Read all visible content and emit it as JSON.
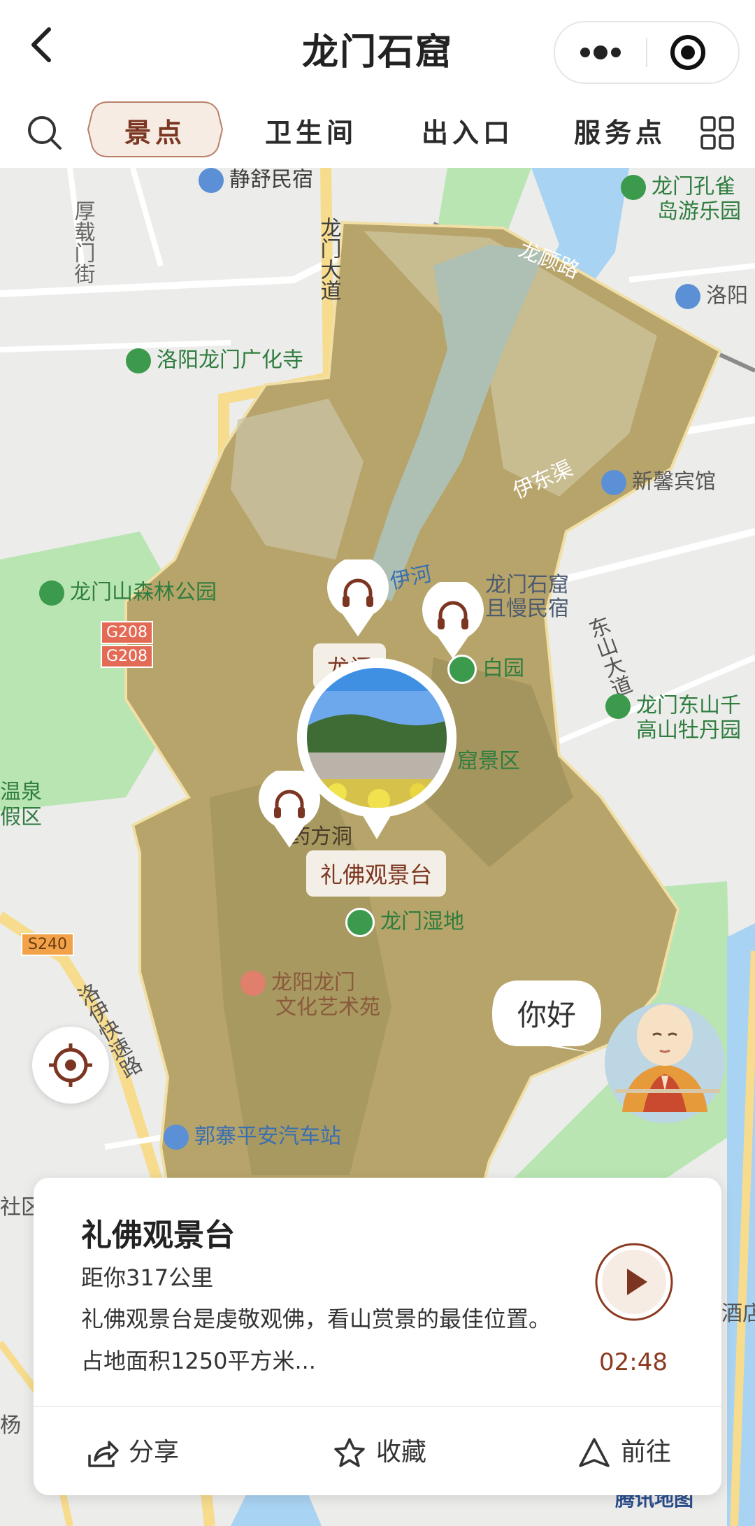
{
  "header": {
    "title": "龙门石窟",
    "back_icon": "chevron-left-icon",
    "more_icon": "more-dots-icon",
    "close_icon": "target-close-icon"
  },
  "tabs": {
    "items": [
      "景点",
      "卫生间",
      "出入口",
      "服务点"
    ],
    "active_index": 0,
    "search_icon": "search-icon",
    "grid_icon": "grid-icon"
  },
  "map": {
    "labels": {
      "jingshu": "静舒民宿",
      "longmen_kongque": "龙门孔雀",
      "dao_youleyuan": "岛游乐园",
      "houzai_jie": "厚载门街",
      "longmen_dadao": "龙门大道",
      "longgu_lu": "龙顾路",
      "luoyang": "洛阳",
      "guanghua_si": "洛阳龙门广化寺",
      "yidong_qu": "伊东渠",
      "xinxin_binguan": "新馨宾馆",
      "senlin_gongyuan": "龙门山森林公园",
      "yi_he": "伊河",
      "minsu_1": "龙门石窟",
      "minsu_2": "且慢民宿",
      "g208": "G208",
      "dongshan_dadao": "东山大道",
      "bai_yuan": "白园",
      "mudan_1": "龙门东山千",
      "mudan_2": "高山牡丹园",
      "shiku_jingqu": "窟景区",
      "wenquan_1": "温泉",
      "wenquan_2": "假区",
      "yaofang_dong": "药方洞",
      "libo_chip": "礼佛观景台",
      "hidden_chip": "龙门",
      "shidi": "龙门湿地",
      "s240": "S240",
      "wenhua_1": "龙阳龙门",
      "wenhua_2": "文化艺术苑",
      "luoyi_kuaisu": "洛伊快速路",
      "qiche_zhan": "郭寨平安汽车站",
      "shequ": "社区",
      "jiudian": "酒店",
      "yang": "杨",
      "tencent": "腾讯地图"
    },
    "bubble_text": "你好",
    "locate_icon": "locate-icon",
    "guide_avatar": "monk-guide-avatar"
  },
  "card": {
    "title": "礼佛观景台",
    "distance": "距你317公里",
    "description": "礼佛观景台是虔敬观佛，看山赏景的最佳位置。占地面积1250平方米...",
    "duration": "02:48",
    "actions": {
      "share": "分享",
      "favorite": "收藏",
      "navigate": "前往"
    }
  },
  "colors": {
    "accent": "#7b3520",
    "active_tab_bg": "#f6ece4",
    "water": "#a9d3f2",
    "park_green": "#a7e0a4",
    "scenic_area": "#b7a46a"
  }
}
